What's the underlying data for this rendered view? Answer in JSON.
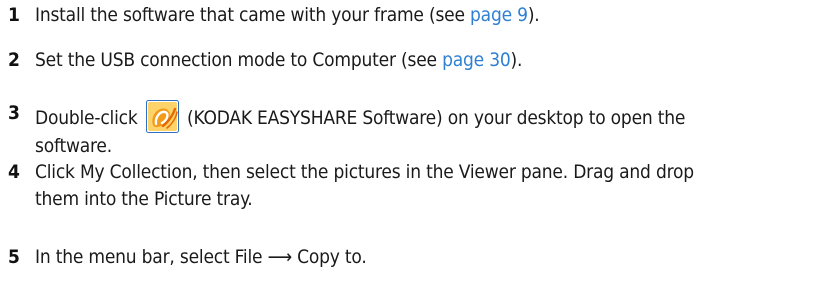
{
  "steps": [
    {
      "number": "1",
      "text_before": "Install the software that came with your frame (see ",
      "link": "page 9",
      "text_after": ")."
    },
    {
      "number": "2",
      "text_before": "Set the USB connection mode to Computer (see ",
      "link": "page 30",
      "text_after": ")."
    },
    {
      "number": "3",
      "text_before": "Double-click ",
      "icon": "kodak-easyshare-icon",
      "text_after": " (KODAK EASYSHARE Software) on your desktop to open the",
      "text_line2": "software."
    },
    {
      "number": "4",
      "text_line1": "Click My Collection, then select the pictures in the Viewer pane. Drag and drop",
      "text_line2": "them into the Picture tray."
    },
    {
      "number": "5",
      "text_before": "In the menu bar, select File ",
      "arrow": "⟶",
      "text_after": " Copy to."
    }
  ],
  "colors": {
    "text": "#1a1a1a",
    "link": "#2f7fd3",
    "icon_orange": "#f39a1b",
    "icon_frame": "#2e6fc4"
  }
}
